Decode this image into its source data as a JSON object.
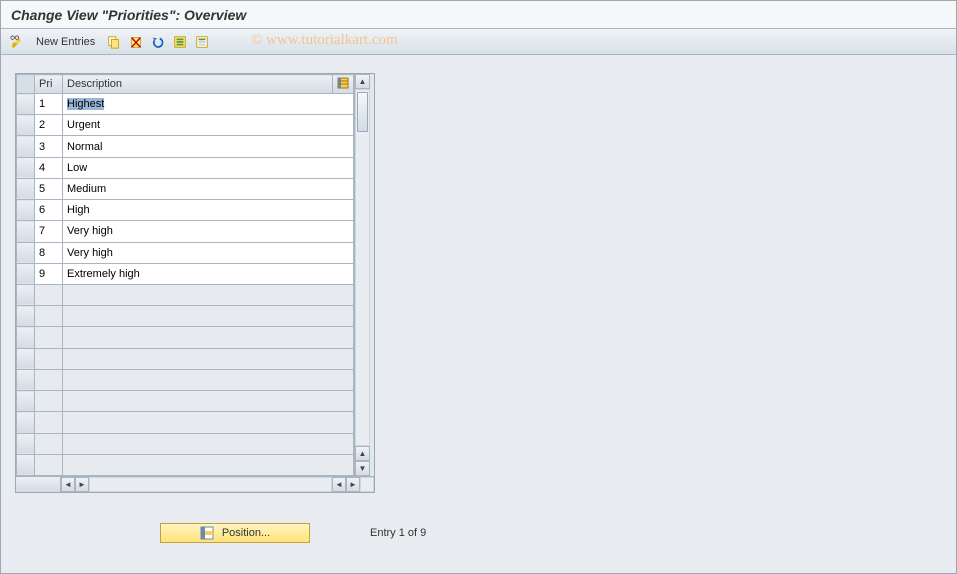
{
  "title": "Change View \"Priorities\": Overview",
  "watermark": "© www.tutorialkart.com",
  "toolbar": {
    "new_entries_label": "New Entries"
  },
  "table": {
    "headers": {
      "pri": "Pri",
      "desc": "Description"
    },
    "rows": [
      {
        "pri": "1",
        "desc": "Highest",
        "selected": true
      },
      {
        "pri": "2",
        "desc": "Urgent"
      },
      {
        "pri": "3",
        "desc": "Normal"
      },
      {
        "pri": "4",
        "desc": "Low"
      },
      {
        "pri": "5",
        "desc": "Medium"
      },
      {
        "pri": "6",
        "desc": "High"
      },
      {
        "pri": "7",
        "desc": "Very high"
      },
      {
        "pri": "8",
        "desc": "Very high"
      },
      {
        "pri": "9",
        "desc": "Extremely high"
      }
    ],
    "empty_row_count": 9
  },
  "footer": {
    "position_label": "Position...",
    "entry_status": "Entry 1 of 9"
  }
}
